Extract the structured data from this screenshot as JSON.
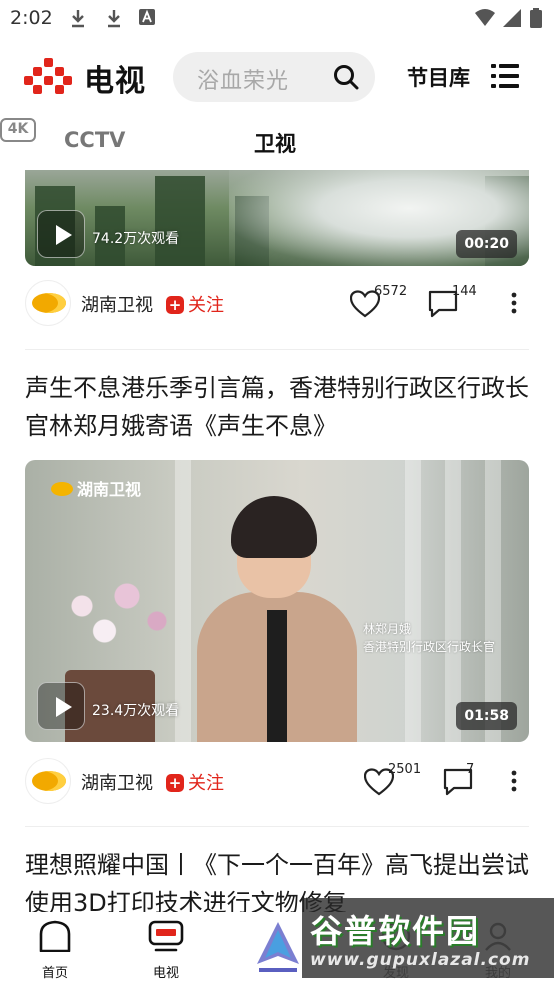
{
  "status_bar": {
    "time": "2:02"
  },
  "header": {
    "brand": "电视",
    "search_placeholder": "浴血荣光",
    "library_label": "节目库"
  },
  "tabs": [
    {
      "label": "CCTV",
      "active": false
    },
    {
      "label": "卫视",
      "active": true
    },
    {
      "label": "4K",
      "active": false
    }
  ],
  "feed": [
    {
      "views": "74.2万次观看",
      "duration": "00:20",
      "channel": "湖南卫视",
      "follow": "关注",
      "likes": "6572",
      "comments": "144"
    },
    {
      "title": "声生不息港乐季引言篇，香港特别行政区行政长官林郑月娥寄语《声生不息》",
      "watermark": "湖南卫视",
      "caption_name": "林郑月娥",
      "caption_role": "香港特别行政区行政长官",
      "views": "23.4万次观看",
      "duration": "01:58",
      "channel": "湖南卫视",
      "follow": "关注",
      "likes": "2501",
      "comments": "7"
    },
    {
      "title": "理想照耀中国丨《下一个一百年》高飞提出尝试使用3D打印技术进行文物修复"
    }
  ],
  "bottom_nav": [
    {
      "label": "首页",
      "icon": "home-icon"
    },
    {
      "label": "电视",
      "icon": "tv-icon"
    },
    {
      "label": "",
      "icon": "center-logo-icon"
    },
    {
      "label": "发现",
      "icon": "discover-icon"
    },
    {
      "label": "我的",
      "icon": "profile-icon"
    }
  ],
  "watermark_overlay": {
    "site_name": "谷普软件园",
    "url": "www.gupuxlazal.com"
  },
  "colors": {
    "accent_red": "#e1251b",
    "text": "#1a1a1a",
    "muted": "#777777"
  }
}
